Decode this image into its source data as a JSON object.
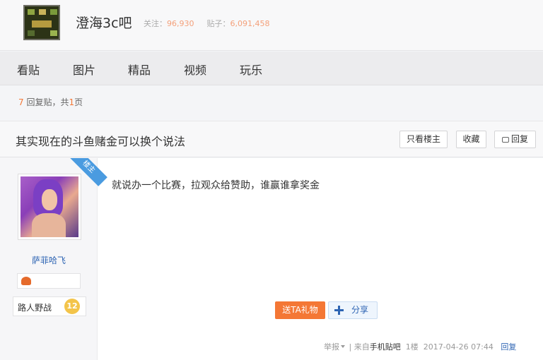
{
  "header": {
    "forum_name": "澄海3c吧",
    "follow_label": "关注：",
    "follow_count": "96,930",
    "posts_label": "贴子：",
    "posts_count": "6,091,458"
  },
  "nav": {
    "items": [
      "看贴",
      "图片",
      "精品",
      "视频",
      "玩乐"
    ]
  },
  "pager": {
    "reply_count": "7",
    "reply_text": " 回复贴，共",
    "page_count": "1",
    "page_suffix": "页"
  },
  "thread": {
    "title": "其实现在的斗鱼赌金可以换个说法",
    "only_owner_label": "只看楼主",
    "favorite_label": "收藏",
    "reply_label": "回复"
  },
  "post": {
    "owner_ribbon": "楼主",
    "username": "萨菲哈飞",
    "level_name": "路人野战",
    "level_number": "12",
    "content": "就说办一个比赛，拉观众给赞助，谁赢谁拿奖金",
    "gift_label": "送TA礼物",
    "share_label": "分享",
    "report_label": "举报",
    "separator": "|",
    "from_label": "来自",
    "source_link": "手机贴吧",
    "floor": "1楼",
    "timestamp": "2017-04-26 07:44",
    "reply_link": "回复"
  },
  "colors": {
    "accent_orange": "#f47735",
    "link_blue": "#2d64b3",
    "ribbon_blue": "#4a9be0"
  }
}
